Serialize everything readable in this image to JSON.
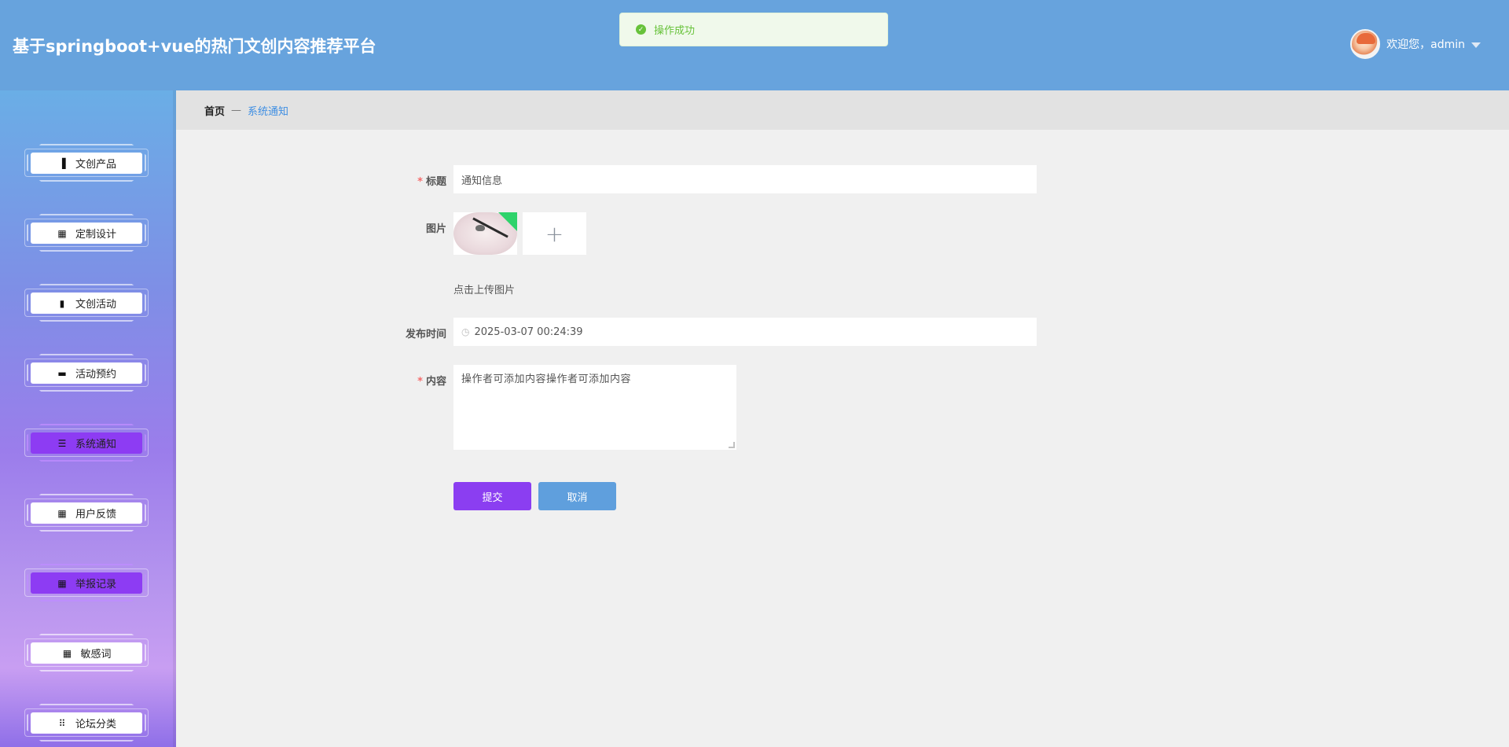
{
  "header": {
    "title": "基于springboot+vue的热门文创内容推荐平台",
    "welcome": "欢迎您，admin"
  },
  "toast": {
    "text": "操作成功"
  },
  "sidebar": {
    "items": [
      {
        "label": "文创产品",
        "icon": "clipboard-icon",
        "active": false
      },
      {
        "label": "定制设计",
        "icon": "grid-icon",
        "active": false
      },
      {
        "label": "文创活动",
        "icon": "bar-chart-icon",
        "active": false
      },
      {
        "label": "活动预约",
        "icon": "chat-icon",
        "active": false
      },
      {
        "label": "系统通知",
        "icon": "list-icon",
        "active": true
      },
      {
        "label": "用户反馈",
        "icon": "grid-icon",
        "active": false
      },
      {
        "label": "举报记录",
        "icon": "grid-icon",
        "active": true
      },
      {
        "label": "敏感词",
        "icon": "grid-icon",
        "active": false
      },
      {
        "label": "论坛分类",
        "icon": "apps-icon",
        "active": false
      }
    ]
  },
  "breadcrumb": {
    "home": "首页",
    "separator": "—",
    "current": "系统通知"
  },
  "form": {
    "title_label": "标题",
    "title_value": "通知信息",
    "image_label": "图片",
    "upload_hint": "点击上传图片",
    "time_label": "发布时间",
    "time_value": "2025-03-07 00:24:39",
    "content_label": "内容",
    "content_value": "操作者可添加内容操作者可添加内容",
    "submit_label": "提交",
    "cancel_label": "取消"
  },
  "colors": {
    "header_bg": "#67a3dd",
    "accent_purple": "#8b3ef1",
    "cancel_blue": "#5f9fdd",
    "success_green": "#67c23a"
  }
}
